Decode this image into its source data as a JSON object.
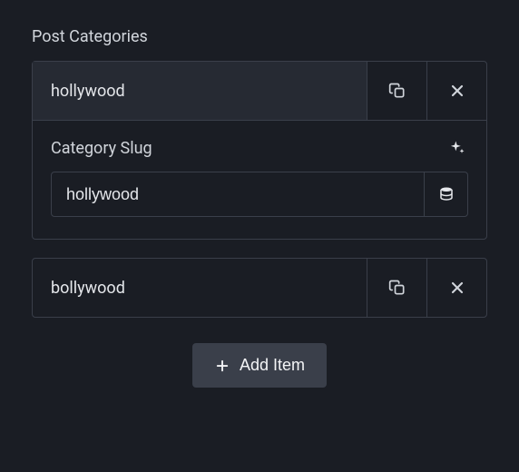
{
  "section": {
    "label": "Post Categories"
  },
  "items": [
    {
      "title": "hollywood",
      "expanded": true
    },
    {
      "title": "bollywood",
      "expanded": false
    }
  ],
  "field": {
    "label": "Category Slug",
    "value": "hollywood"
  },
  "add_button": {
    "label": "Add Item"
  }
}
